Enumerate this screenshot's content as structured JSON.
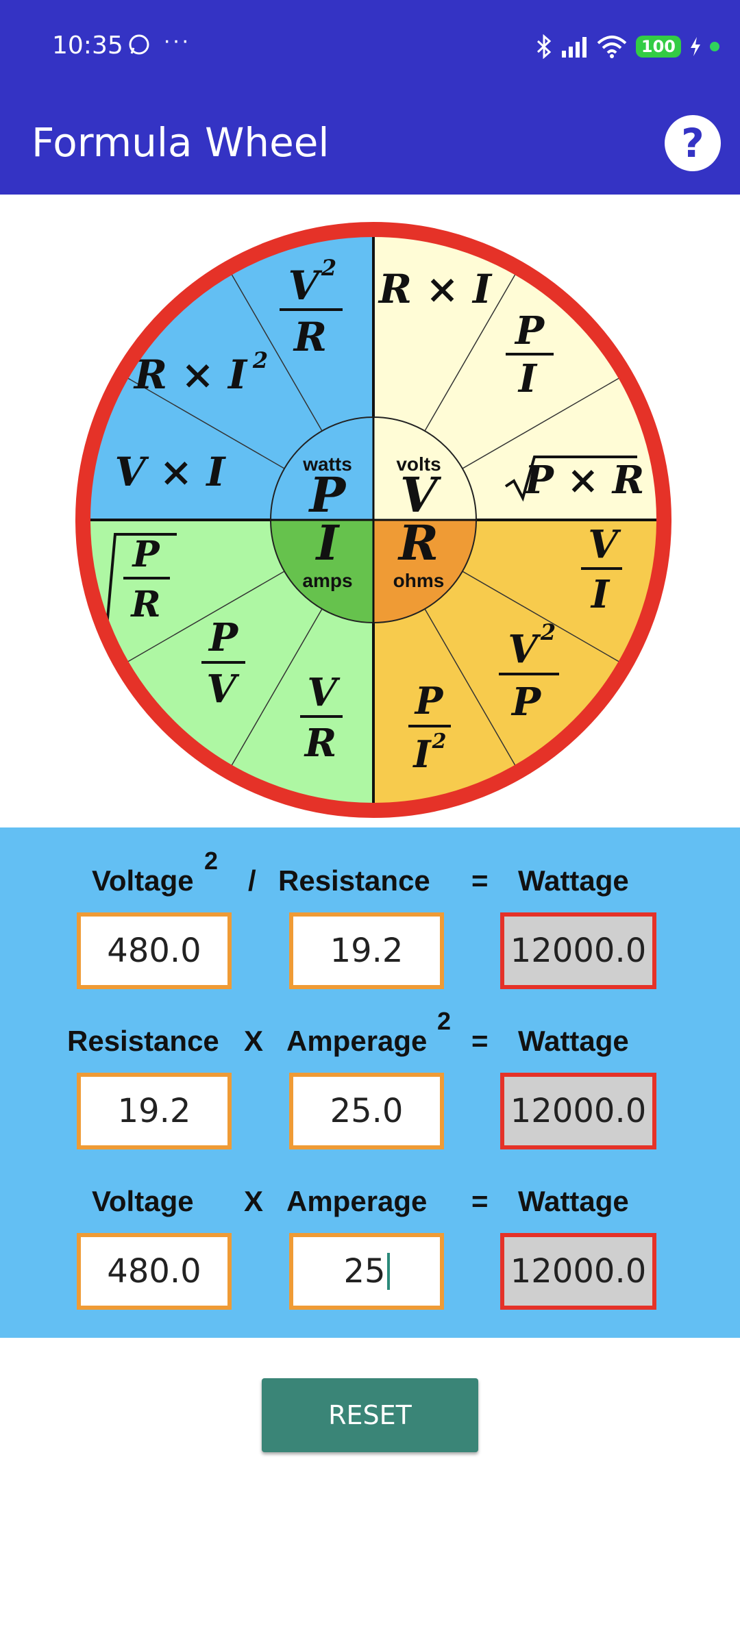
{
  "status": {
    "time": "10:35",
    "dots": "···",
    "battery": "100"
  },
  "appbar": {
    "title": "Formula Wheel",
    "help_icon": "?"
  },
  "wheel": {
    "colors": {
      "rim": "#e53228",
      "watts": "#63bff3",
      "volts": "#fffcd6",
      "amps": "#aef7a3",
      "ohms": "#f7cb4d",
      "watts_center": "#63bff3",
      "volts_center": "#fffcd6",
      "amps_center": "#66c24d",
      "ohms_center": "#ef9b35"
    },
    "center": {
      "P": "P",
      "watts": "watts",
      "V": "V",
      "volts": "volts",
      "I": "I",
      "amps": "amps",
      "R": "R",
      "ohms": "ohms"
    },
    "formulas": {
      "p1_num": "V",
      "p1_exp": "2",
      "p1_den": "R",
      "p2_a": "R × I",
      "p2_exp": "2",
      "p3": "V × I",
      "v1": "R × I",
      "v2_num": "P",
      "v2_den": "I",
      "v3": "P × R",
      "r1_num": "V",
      "r1_den": "I",
      "r2_num": "V",
      "r2_exp": "2",
      "r2_den": "P",
      "r3_num": "P",
      "r3_den": "I",
      "r3_exp": "2",
      "i1_num": "V",
      "i1_den": "R",
      "i2_num": "P",
      "i2_den": "V",
      "i3_num": "P",
      "i3_den": "R"
    }
  },
  "calc": {
    "row1": {
      "a": "Voltage",
      "a_sup": "2",
      "op": "/",
      "b": "Resistance",
      "eq": "=",
      "c": "Wattage",
      "in1": "480.0",
      "in2": "19.2",
      "out": "12000.0"
    },
    "row2": {
      "a": "Resistance",
      "op": "X",
      "b": "Amperage",
      "b_sup": "2",
      "eq": "=",
      "c": "Wattage",
      "in1": "19.2",
      "in2": "25.0",
      "out": "12000.0"
    },
    "row3": {
      "a": "Voltage",
      "op": "X",
      "b": "Amperage",
      "eq": "=",
      "c": "Wattage",
      "in1": "480.0",
      "in2": "25",
      "out": "12000.0"
    }
  },
  "reset_label": "RESET"
}
